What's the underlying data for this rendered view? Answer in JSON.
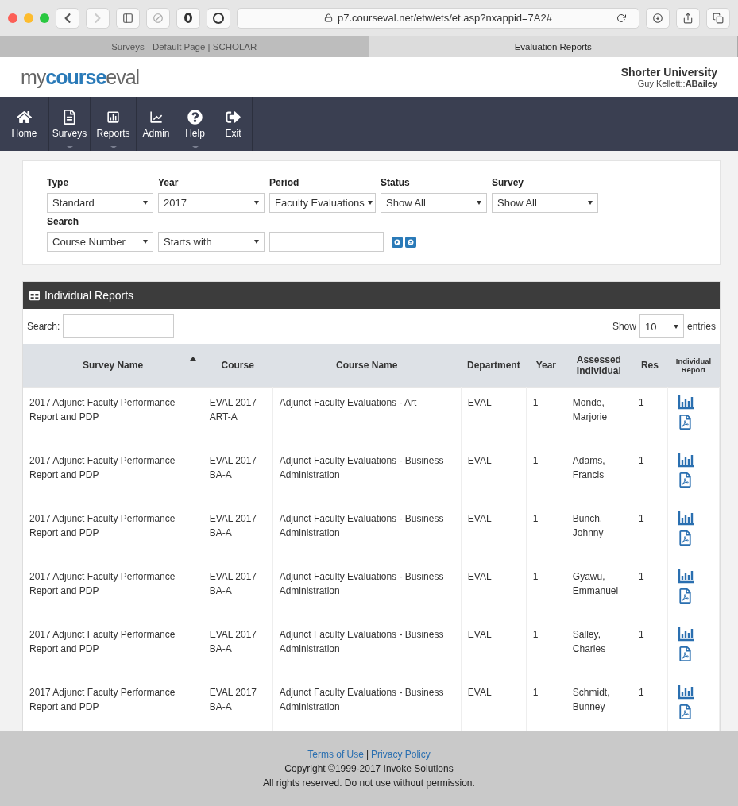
{
  "browser": {
    "url": "p7.courseval.net/etw/ets/et.asp?nxappid=7A2#",
    "tabs": [
      {
        "title": "Surveys - Default Page | SCHOLAR",
        "selected": false
      },
      {
        "title": "Evaluation Reports",
        "selected": true
      }
    ]
  },
  "header": {
    "logo": [
      "my",
      "course",
      "eval"
    ],
    "institution": "Shorter University",
    "user_prefix": "Guy Kellett::",
    "user_name": "ABailey"
  },
  "nav": [
    {
      "label": "Home",
      "has_menu": false
    },
    {
      "label": "Surveys",
      "has_menu": true
    },
    {
      "label": "Reports",
      "has_menu": true
    },
    {
      "label": "Admin",
      "has_menu": false
    },
    {
      "label": "Help",
      "has_menu": true
    },
    {
      "label": "Exit",
      "has_menu": false
    }
  ],
  "filters": [
    {
      "label": "Type",
      "value": "Standard"
    },
    {
      "label": "Year",
      "value": "2017"
    },
    {
      "label": "Period",
      "value": "Faculty Evaluations"
    },
    {
      "label": "Status",
      "value": "Show All"
    },
    {
      "label": "Survey",
      "value": "Show All"
    }
  ],
  "search": {
    "label": "Search",
    "field": "Course Number",
    "mode": "Starts with"
  },
  "reports": {
    "title": "Individual Reports",
    "search_label": "Search:",
    "show_label": "Show",
    "page_size": "10",
    "entries_label": "entries",
    "columns": [
      {
        "label": "Survey Name",
        "sorted": true
      },
      {
        "label": "Course",
        "sorted": false
      },
      {
        "label": "Course Name",
        "sorted": false
      },
      {
        "label": "Department",
        "sorted": false
      },
      {
        "label": "Year",
        "sorted": false
      },
      {
        "label": "Assessed Individual",
        "sorted": false
      },
      {
        "label": "Res",
        "sorted": false
      },
      {
        "label": "Individual Report",
        "sorted": false
      }
    ],
    "rows": [
      {
        "survey": "2017 Adjunct Faculty Performance Report and PDP",
        "course": "EVAL 2017 ART-A",
        "course_name": "Adjunct Faculty Evaluations - Art",
        "department": "EVAL",
        "year": "1",
        "individual": "Monde, Marjorie",
        "res": "1"
      },
      {
        "survey": "2017 Adjunct Faculty Performance Report and PDP",
        "course": "EVAL 2017 BA-A",
        "course_name": "Adjunct Faculty Evaluations - Business Administration",
        "department": "EVAL",
        "year": "1",
        "individual": "Adams, Francis",
        "res": "1"
      },
      {
        "survey": "2017 Adjunct Faculty Performance Report and PDP",
        "course": "EVAL 2017 BA-A",
        "course_name": "Adjunct Faculty Evaluations - Business Administration",
        "department": "EVAL",
        "year": "1",
        "individual": "Bunch, Johnny",
        "res": "1"
      },
      {
        "survey": "2017 Adjunct Faculty Performance Report and PDP",
        "course": "EVAL 2017 BA-A",
        "course_name": "Adjunct Faculty Evaluations - Business Administration",
        "department": "EVAL",
        "year": "1",
        "individual": "Gyawu, Emmanuel",
        "res": "1"
      },
      {
        "survey": "2017 Adjunct Faculty Performance Report and PDP",
        "course": "EVAL 2017 BA-A",
        "course_name": "Adjunct Faculty Evaluations - Business Administration",
        "department": "EVAL",
        "year": "1",
        "individual": "Salley, Charles",
        "res": "1"
      },
      {
        "survey": "2017 Adjunct Faculty Performance Report and PDP",
        "course": "EVAL 2017 BA-A",
        "course_name": "Adjunct Faculty Evaluations - Business Administration",
        "department": "EVAL",
        "year": "1",
        "individual": "Schmidt, Bunney",
        "res": "1"
      }
    ]
  },
  "footer": {
    "links": [
      "Terms of Use",
      "Privacy Policy"
    ],
    "separator": "|",
    "copyright": "Copyright ©1999-2017 Invoke Solutions",
    "rights": "All rights reserved. Do not use without permission."
  }
}
